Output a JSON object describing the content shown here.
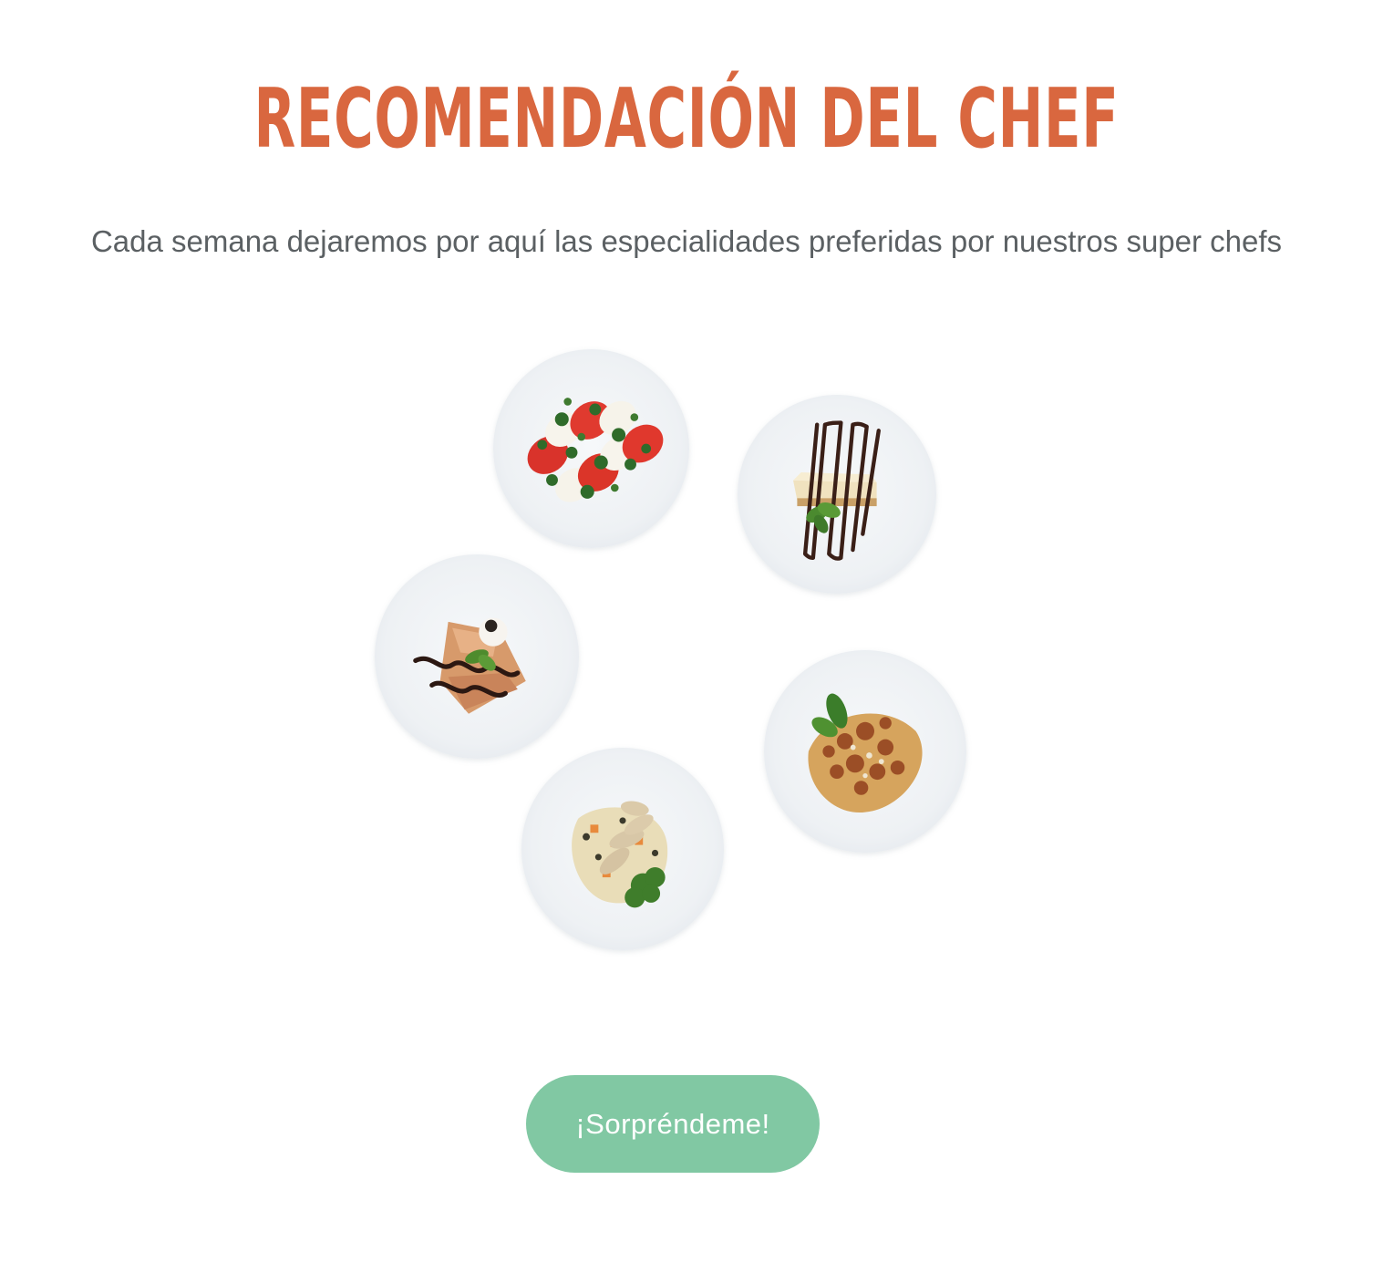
{
  "section": {
    "title": "RECOMENDACIÓN DEL CHEF",
    "subtitle": "Cada semana dejaremos por aquí las especialidades preferidas por nuestros super chefs"
  },
  "dishes": [
    {
      "icon": "caprese-salad-plate"
    },
    {
      "icon": "cheesecake-plate"
    },
    {
      "icon": "crepes-plate"
    },
    {
      "icon": "tagliatelle-bolognese-plate"
    },
    {
      "icon": "chicken-rice-plate"
    }
  ],
  "cta": {
    "label": "¡Sorpréndeme!"
  },
  "colors": {
    "title": "#d9673f",
    "subtitle": "#5b6063",
    "button": "#81c8a3",
    "button_text": "#ffffff"
  }
}
